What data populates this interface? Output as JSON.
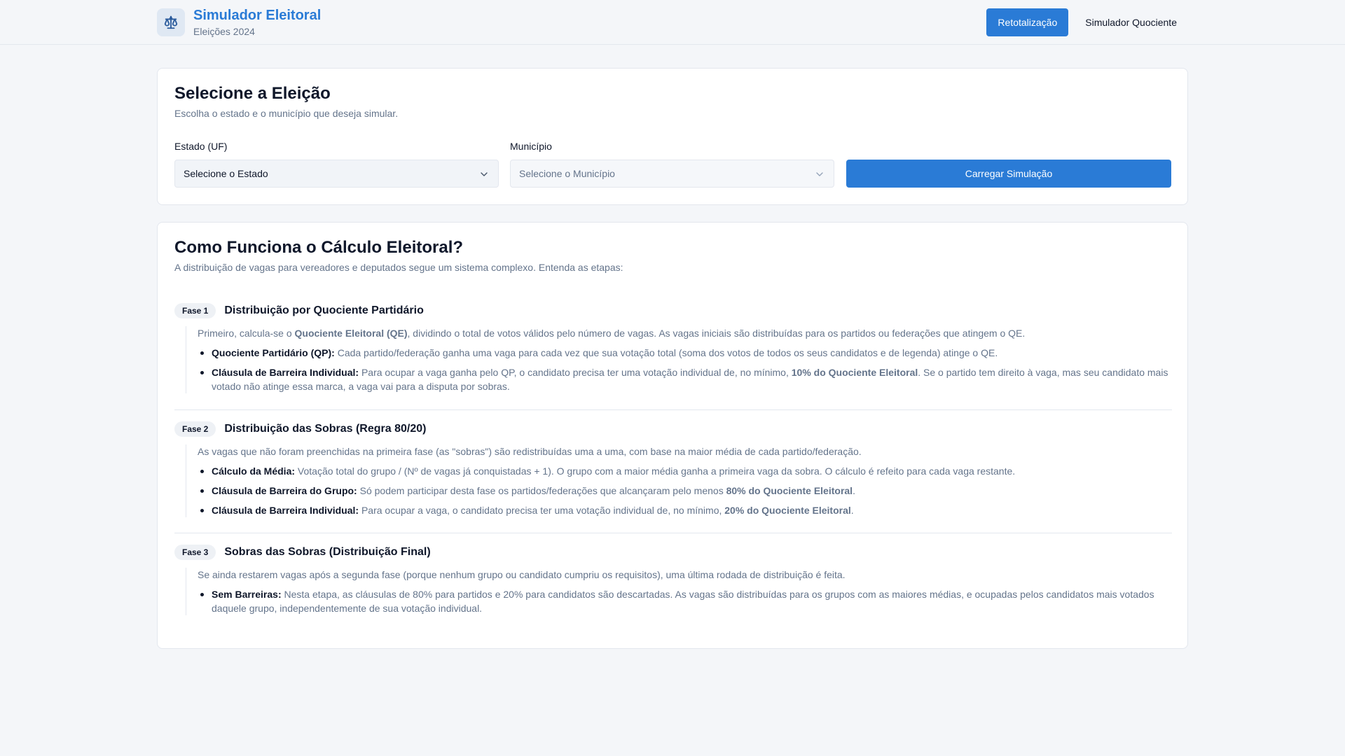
{
  "header": {
    "title": "Simulador Eleitoral",
    "subtitle": "Eleições 2024",
    "logo_icon": "scale-icon",
    "nav": [
      {
        "label": "Retotalização",
        "active": true
      },
      {
        "label": "Simulador Quociente",
        "active": false
      }
    ]
  },
  "select_card": {
    "title": "Selecione a Eleição",
    "subtitle": "Escolha o estado e o município que deseja simular.",
    "state_label": "Estado (UF)",
    "state_placeholder": "Selecione o Estado",
    "city_label": "Município",
    "city_placeholder": "Selecione o Município",
    "load_button": "Carregar Simulação"
  },
  "info_card": {
    "title": "Como Funciona o Cálculo Eleitoral?",
    "subtitle": "A distribuição de vagas para vereadores e deputados segue um sistema complexo. Entenda as etapas:",
    "phases": [
      {
        "badge": "Fase 1",
        "title": "Distribuição por Quociente Partidário",
        "intro": {
          "t1": "Primeiro, calcula-se o ",
          "b1": "Quociente Eleitoral (QE)",
          "t2": ", dividindo o total de votos válidos pelo número de vagas. As vagas iniciais são distribuídas para os partidos ou federações que atingem o QE."
        },
        "items": [
          {
            "term": "Quociente Partidário (QP):",
            "t1": " Cada partido/federação ganha uma vaga para cada vez que sua votação total (soma dos votos de todos os seus candidatos e de legenda) atinge o QE.",
            "b1": "",
            "t2": ""
          },
          {
            "term": "Cláusula de Barreira Individual:",
            "t1": " Para ocupar a vaga ganha pelo QP, o candidato precisa ter uma votação individual de, no mínimo, ",
            "b1": "10% do Quociente Eleitoral",
            "t2": ". Se o partido tem direito à vaga, mas seu candidato mais votado não atinge essa marca, a vaga vai para a disputa por sobras."
          }
        ]
      },
      {
        "badge": "Fase 2",
        "title": "Distribuição das Sobras (Regra 80/20)",
        "intro": {
          "t1": "As vagas que não foram preenchidas na primeira fase (as \"sobras\") são redistribuídas uma a uma, com base na maior média de cada partido/federação.",
          "b1": "",
          "t2": ""
        },
        "items": [
          {
            "term": "Cálculo da Média:",
            "t1": " Votação total do grupo / (Nº de vagas já conquistadas + 1). O grupo com a maior média ganha a primeira vaga da sobra. O cálculo é refeito para cada vaga restante.",
            "b1": "",
            "t2": ""
          },
          {
            "term": "Cláusula de Barreira do Grupo:",
            "t1": " Só podem participar desta fase os partidos/federações que alcançaram pelo menos ",
            "b1": "80% do Quociente Eleitoral",
            "t2": "."
          },
          {
            "term": "Cláusula de Barreira Individual:",
            "t1": " Para ocupar a vaga, o candidato precisa ter uma votação individual de, no mínimo, ",
            "b1": "20% do Quociente Eleitoral",
            "t2": "."
          }
        ]
      },
      {
        "badge": "Fase 3",
        "title": "Sobras das Sobras (Distribuição Final)",
        "intro": {
          "t1": "Se ainda restarem vagas após a segunda fase (porque nenhum grupo ou candidato cumpriu os requisitos), uma última rodada de distribuição é feita.",
          "b1": "",
          "t2": ""
        },
        "items": [
          {
            "term": "Sem Barreiras:",
            "t1": " Nesta etapa, as cláusulas de 80% para partidos e 20% para candidatos são descartadas. As vagas são distribuídas para os grupos com as maiores médias, e ocupadas pelos candidatos mais votados daquele grupo, independentemente de sua votação individual.",
            "b1": "",
            "t2": ""
          }
        ]
      }
    ]
  },
  "colors": {
    "accent": "#2a7bd6",
    "background": "#f4f6f9",
    "muted_text": "#64748b",
    "border": "#e3e7ee"
  }
}
